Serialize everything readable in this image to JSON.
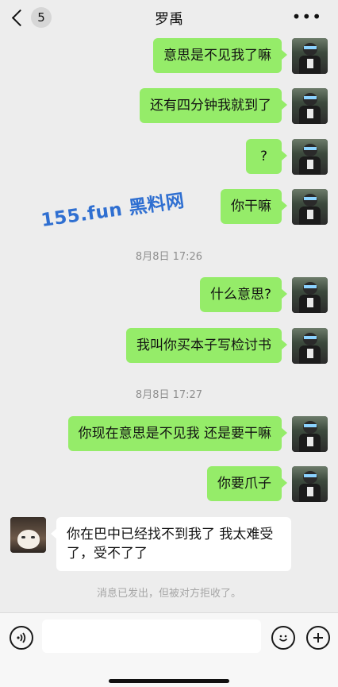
{
  "header": {
    "back_count": "5",
    "title": "罗禹"
  },
  "watermark": "155.fun 黑料网",
  "messages": [
    {
      "text": "意思是不见我了嘛"
    },
    {
      "text": "还有四分钟我就到了"
    },
    {
      "text": "?"
    },
    {
      "text": "你干嘛"
    },
    {
      "text": "什么意思?"
    },
    {
      "text": "我叫你买本子写检讨书"
    },
    {
      "text": "你现在意思是不见我 还是要干嘛"
    },
    {
      "text": "你要爪子"
    }
  ],
  "incoming": {
    "text": "你在巴中已经找不到我了 我太难受了，受不了了"
  },
  "timestamps": [
    "8月8日 17:26",
    "8月8日 17:27"
  ],
  "system_notice": "消息已发出，但被对方拒收了。",
  "colors": {
    "sent_bubble": "#95ec69",
    "received_bubble": "#ffffff",
    "background": "#ededed"
  }
}
